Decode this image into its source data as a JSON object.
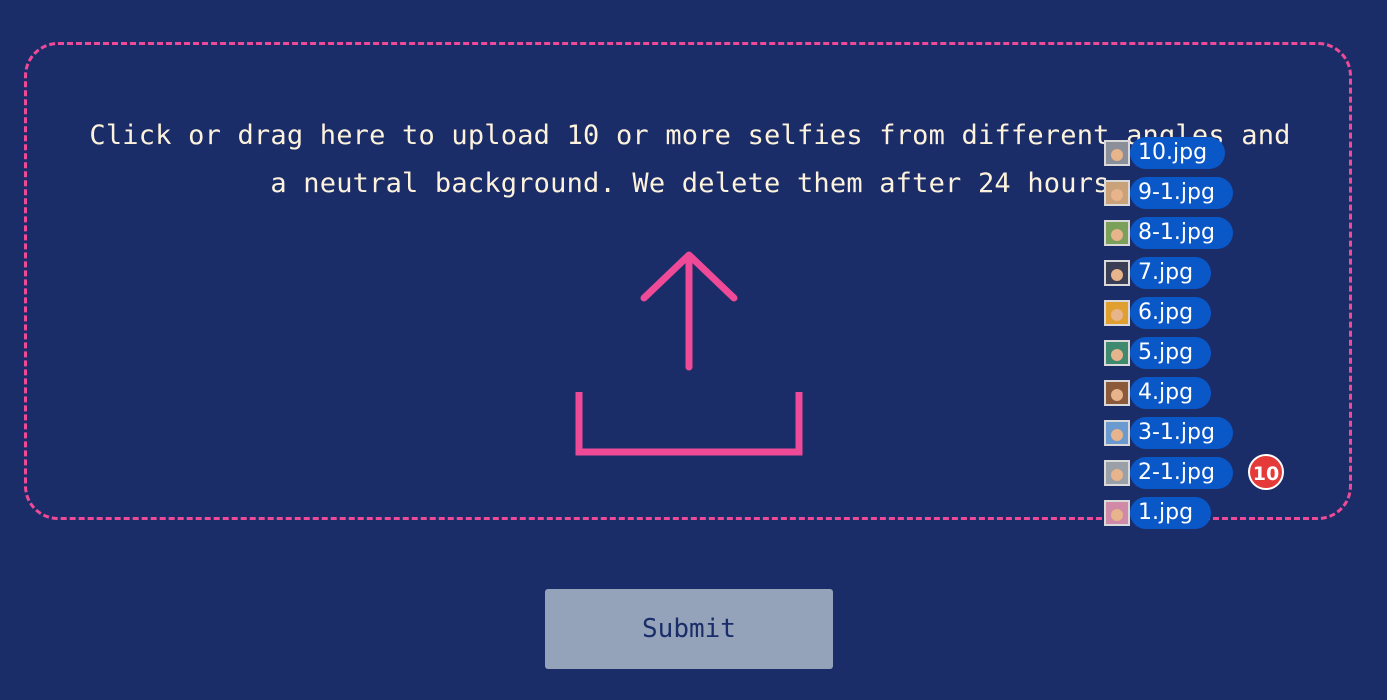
{
  "dropzone": {
    "instructions": "Click or drag here to upload 10 or more selfies from different angles and a neutral background. We delete them after 24 hours",
    "icon": "upload-icon",
    "accent_color": "#ee4a97"
  },
  "dragged_files": {
    "items": [
      {
        "name": "10.jpg",
        "thumb_bg": "#8a8f99"
      },
      {
        "name": "9-1.jpg",
        "thumb_bg": "#c9a27a"
      },
      {
        "name": "8-1.jpg",
        "thumb_bg": "#7aa05a"
      },
      {
        "name": "7.jpg",
        "thumb_bg": "#3a3f55"
      },
      {
        "name": "6.jpg",
        "thumb_bg": "#e0a030"
      },
      {
        "name": "5.jpg",
        "thumb_bg": "#3f8a6e"
      },
      {
        "name": "4.jpg",
        "thumb_bg": "#8a5a3a"
      },
      {
        "name": "3-1.jpg",
        "thumb_bg": "#6a9ad0"
      },
      {
        "name": "2-1.jpg",
        "thumb_bg": "#9aa0a8"
      },
      {
        "name": "1.jpg",
        "thumb_bg": "#d08aa8"
      }
    ],
    "count": "10",
    "pill_color": "#0a58c8",
    "badge_color": "#e53a3a"
  },
  "form": {
    "submit_label": "Submit"
  },
  "colors": {
    "background": "#1b2d69",
    "text": "#fdf3dc",
    "button": "#94a3ba"
  }
}
